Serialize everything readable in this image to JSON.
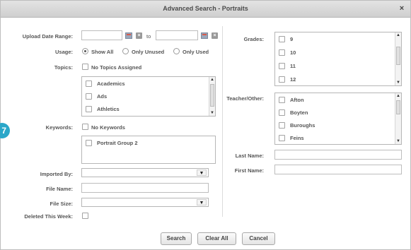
{
  "dialog": {
    "title": "Advanced Search - Portraits",
    "close_glyph": "×"
  },
  "badge_number": "7",
  "left": {
    "upload_date": {
      "label": "Upload Date Range:",
      "to_label": "to",
      "from_value": "",
      "to_value": ""
    },
    "usage": {
      "label": "Usage:",
      "options": [
        "Show All",
        "Only Unused",
        "Only Used"
      ],
      "selected": "Show All"
    },
    "topics": {
      "label": "Topics:",
      "none_label": "No Topics Assigned",
      "items": [
        "Academics",
        "Ads",
        "Athletics"
      ]
    },
    "keywords": {
      "label": "Keywords:",
      "none_label": "No Keywords",
      "items": [
        "Portrait Group 2"
      ]
    },
    "imported_by": {
      "label": "Imported By:",
      "value": ""
    },
    "file_name": {
      "label": "File Name:",
      "value": ""
    },
    "file_size": {
      "label": "File Size:",
      "value": ""
    },
    "deleted": {
      "label": "Deleted This Week:"
    }
  },
  "right": {
    "grades": {
      "label": "Grades:",
      "items": [
        "9",
        "10",
        "11",
        "12"
      ]
    },
    "teacher": {
      "label": "Teacher/Other:",
      "items": [
        "Afton",
        "Boyten",
        "Buroughs",
        "Feins"
      ]
    },
    "last_name": {
      "label": "Last Name:",
      "value": ""
    },
    "first_name": {
      "label": "First Name:",
      "value": ""
    }
  },
  "buttons": {
    "search": "Search",
    "clear_all": "Clear All",
    "cancel": "Cancel"
  },
  "icons": {
    "calendar": "calendar-icon",
    "clear": "clear-x-icon",
    "dropdown": "chevron-down-icon",
    "scroll_up": "▲",
    "scroll_down": "▼"
  }
}
